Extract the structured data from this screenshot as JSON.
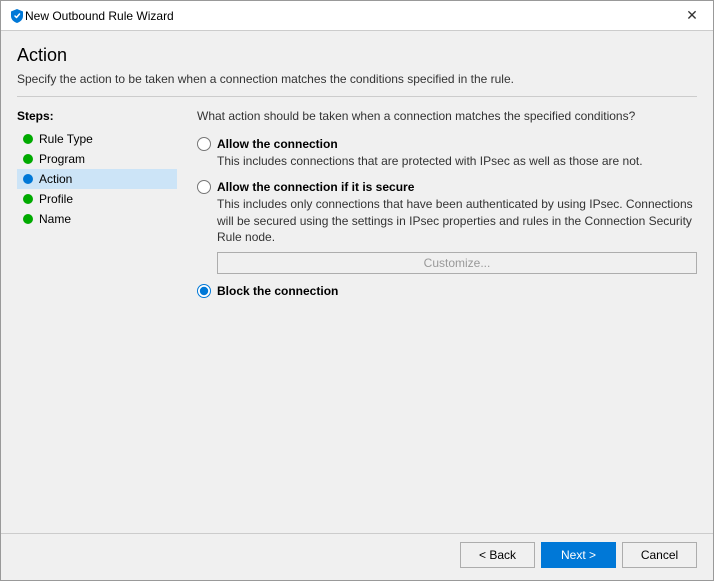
{
  "window": {
    "title": "New Outbound Rule Wizard",
    "close_label": "✕"
  },
  "header": {
    "title": "Action",
    "description": "Specify the action to be taken when a connection matches the conditions specified in the rule."
  },
  "sidebar": {
    "steps_label": "Steps:",
    "items": [
      {
        "id": "rule-type",
        "label": "Rule Type",
        "dot_class": "dot-green",
        "active": false
      },
      {
        "id": "program",
        "label": "Program",
        "dot_class": "dot-green",
        "active": false
      },
      {
        "id": "action",
        "label": "Action",
        "dot_class": "dot-blue",
        "active": true
      },
      {
        "id": "profile",
        "label": "Profile",
        "dot_class": "dot-green",
        "active": false
      },
      {
        "id": "name",
        "label": "Name",
        "dot_class": "dot-green",
        "active": false
      }
    ]
  },
  "content": {
    "question": "What action should be taken when a connection matches the specified conditions?",
    "options": [
      {
        "id": "allow",
        "label": "Allow the connection",
        "description": "This includes connections that are protected with IPsec as well as those are not.",
        "checked": false,
        "has_customize": false
      },
      {
        "id": "allow-secure",
        "label": "Allow the connection if it is secure",
        "description": "This includes only connections that have been authenticated by using IPsec.  Connections will be secured using the settings in IPsec properties and rules in the Connection Security Rule node.",
        "checked": false,
        "has_customize": true,
        "customize_label": "Customize..."
      },
      {
        "id": "block",
        "label": "Block the connection",
        "description": "",
        "checked": true,
        "has_customize": false
      }
    ]
  },
  "footer": {
    "back_label": "< Back",
    "next_label": "Next >",
    "cancel_label": "Cancel"
  }
}
